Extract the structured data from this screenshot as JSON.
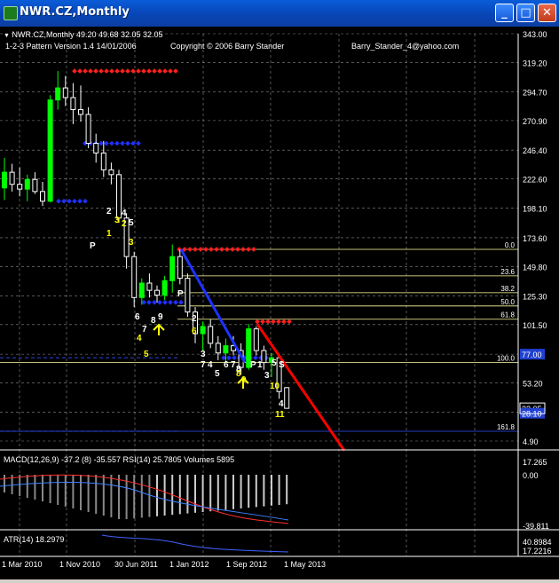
{
  "window": {
    "title": "NWR.CZ,Monthly",
    "buttons": {
      "minimize": "_",
      "maximize": "□",
      "close": "✕"
    }
  },
  "header": {
    "symbol_line": "NWR.CZ,Monthly  49.20 49.68 32.05 32.05",
    "indicator_name": "1-2-3 Pattern  Version 1.4  14/01/2006",
    "copyright": "Copyright © 2006 Barry Stander",
    "email": "Barry_Stander_4@yahoo.com"
  },
  "price_axis": [
    "343.00",
    "319.20",
    "294.70",
    "270.90",
    "246.40",
    "222.60",
    "198.10",
    "173.60",
    "149.80",
    "125.30",
    "101.50",
    "77.00",
    "53.20",
    "28.70",
    "4.90"
  ],
  "price_badges": {
    "current": "32.05",
    "level_100": "77.00",
    "level_161": "28.10"
  },
  "fib_levels": [
    {
      "label": "0.0",
      "price": 164
    },
    {
      "label": "23.6",
      "price": 142
    },
    {
      "label": "38.2",
      "price": 128
    },
    {
      "label": "50.0",
      "price": 117
    },
    {
      "label": "61.8",
      "price": 106
    },
    {
      "label": "100.0",
      "price": 70
    },
    {
      "label": "161.8",
      "price": 13
    }
  ],
  "subwindow1": {
    "label": "MACD(12,26,9) -37.2 (8) -35.557  RSI(14) 25.7805  Volumes 5895",
    "axis": [
      "17.265",
      "0.00",
      "-39.811"
    ]
  },
  "subwindow2": {
    "label": "ATR(14) 18.2979",
    "axis": [
      "40.8984",
      "17.2216"
    ]
  },
  "time_axis": [
    "1 Mar 2010",
    "1 Nov 2010",
    "30 Jun 2011",
    "1 Jan 2012",
    "1 Sep 2012",
    "1 May 2013"
  ],
  "colors": {
    "bull": "#00ff00",
    "bear": "#ffffff",
    "resistance": "#ff2020",
    "support": "#2030ff",
    "trend_blue": "#1e32ff",
    "trend_red": "#ff0000",
    "fib": "#ffffa0",
    "grid": "#8a8a8a"
  },
  "chart_data": {
    "type": "candlestick",
    "title": "NWR.CZ,Monthly",
    "timeframe": "Monthly",
    "last_ohlc": {
      "open": 49.2,
      "high": 49.68,
      "low": 32.05,
      "close": 32.05
    },
    "candles": [
      {
        "o": 215,
        "h": 240,
        "l": 205,
        "c": 228
      },
      {
        "o": 228,
        "h": 235,
        "l": 212,
        "c": 218
      },
      {
        "o": 218,
        "h": 232,
        "l": 208,
        "c": 214
      },
      {
        "o": 214,
        "h": 226,
        "l": 204,
        "c": 222
      },
      {
        "o": 222,
        "h": 228,
        "l": 210,
        "c": 212
      },
      {
        "o": 212,
        "h": 220,
        "l": 200,
        "c": 204
      },
      {
        "o": 204,
        "h": 292,
        "l": 203,
        "c": 288
      },
      {
        "o": 288,
        "h": 312,
        "l": 280,
        "c": 298
      },
      {
        "o": 298,
        "h": 308,
        "l": 283,
        "c": 290
      },
      {
        "o": 290,
        "h": 302,
        "l": 268,
        "c": 280
      },
      {
        "o": 280,
        "h": 300,
        "l": 270,
        "c": 276
      },
      {
        "o": 276,
        "h": 282,
        "l": 248,
        "c": 252
      },
      {
        "o": 252,
        "h": 260,
        "l": 236,
        "c": 244
      },
      {
        "o": 244,
        "h": 254,
        "l": 224,
        "c": 230
      },
      {
        "o": 230,
        "h": 236,
        "l": 218,
        "c": 226
      },
      {
        "o": 226,
        "h": 230,
        "l": 186,
        "c": 190
      },
      {
        "o": 190,
        "h": 194,
        "l": 148,
        "c": 158
      },
      {
        "o": 158,
        "h": 162,
        "l": 116,
        "c": 124
      },
      {
        "o": 124,
        "h": 140,
        "l": 118,
        "c": 136
      },
      {
        "o": 136,
        "h": 144,
        "l": 124,
        "c": 130
      },
      {
        "o": 130,
        "h": 134,
        "l": 120,
        "c": 126
      },
      {
        "o": 126,
        "h": 142,
        "l": 122,
        "c": 138
      },
      {
        "o": 138,
        "h": 168,
        "l": 128,
        "c": 158
      },
      {
        "o": 158,
        "h": 164,
        "l": 135,
        "c": 140
      },
      {
        "o": 140,
        "h": 144,
        "l": 108,
        "c": 112
      },
      {
        "o": 112,
        "h": 116,
        "l": 86,
        "c": 94
      },
      {
        "o": 94,
        "h": 104,
        "l": 80,
        "c": 100
      },
      {
        "o": 100,
        "h": 106,
        "l": 82,
        "c": 86
      },
      {
        "o": 86,
        "h": 92,
        "l": 72,
        "c": 78
      },
      {
        "o": 78,
        "h": 90,
        "l": 70,
        "c": 84
      },
      {
        "o": 84,
        "h": 92,
        "l": 76,
        "c": 80
      },
      {
        "o": 80,
        "h": 86,
        "l": 60,
        "c": 66
      },
      {
        "o": 66,
        "h": 102,
        "l": 64,
        "c": 98
      },
      {
        "o": 98,
        "h": 100,
        "l": 76,
        "c": 80
      },
      {
        "o": 80,
        "h": 84,
        "l": 64,
        "c": 70
      },
      {
        "o": 70,
        "h": 78,
        "l": 58,
        "c": 74
      },
      {
        "o": 74,
        "h": 76,
        "l": 40,
        "c": 46
      },
      {
        "o": 49.2,
        "h": 49.68,
        "l": 32.05,
        "c": 32.05
      }
    ],
    "markers": {
      "resistance_levels": [
        312,
        164,
        104
      ],
      "support_levels": [
        252,
        204,
        120,
        74
      ]
    }
  }
}
